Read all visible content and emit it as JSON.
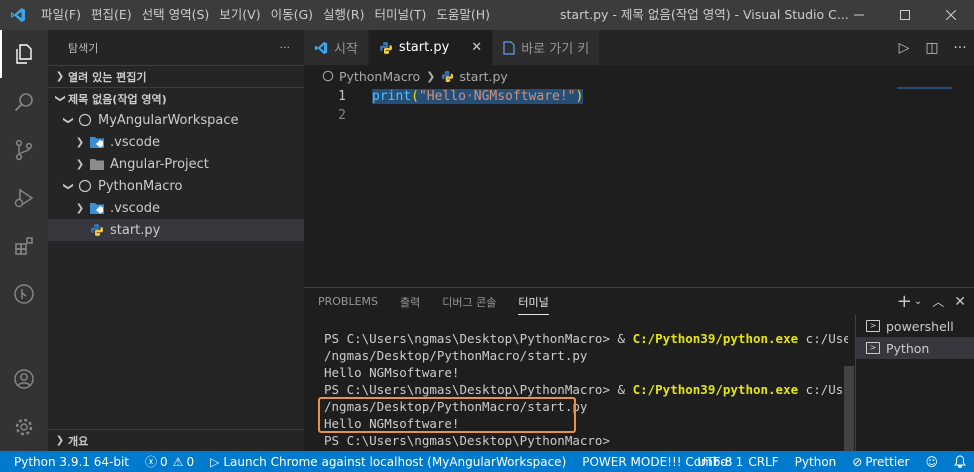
{
  "titlebar": {
    "menu": [
      "파일(F)",
      "편집(E)",
      "선택 영역(S)",
      "보기(V)",
      "이동(G)",
      "실행(R)",
      "터미널(T)",
      "도움말(H)"
    ],
    "title": "start.py - 제목 없음(작업 영역) - Visual Studio C..."
  },
  "sidebar": {
    "header": "탐색기",
    "more": "···",
    "open_editors": "열려 있는 편집기",
    "workspace": "제목 없음(작업 영역)",
    "tree": [
      {
        "label": "MyAngularWorkspace"
      },
      {
        "label": ".vscode"
      },
      {
        "label": "Angular-Project"
      },
      {
        "label": "PythonMacro"
      },
      {
        "label": ".vscode"
      },
      {
        "label": "start.py"
      }
    ],
    "outline": "개요"
  },
  "tabs": [
    {
      "label": "시작"
    },
    {
      "label": "start.py",
      "close": "✕"
    },
    {
      "label": "바로 가기 키"
    }
  ],
  "breadcrumb": {
    "folder": "PythonMacro",
    "file": "start.py"
  },
  "editor": {
    "lines": [
      {
        "num": "1",
        "fn": "print",
        "open": "(",
        "str": "\"Hello·NGMsoftware!\"",
        "close": ")"
      },
      {
        "num": "2"
      }
    ]
  },
  "panel": {
    "tabs": [
      "PROBLEMS",
      "출력",
      "디버그 콘솔",
      "터미널"
    ],
    "terminal": {
      "line1_prefix": "PS C:\\Users\\ngmas\\Desktop\\PythonMacro> & ",
      "line1_cmd": "C:/Python39/python.exe",
      "line1_suffix": " c:/Users",
      "line2": "/ngmas/Desktop/PythonMacro/start.py",
      "line3": "Hello NGMsoftware!",
      "line4_prefix": "PS C:\\Users\\ngmas\\Desktop\\PythonMacro> & ",
      "line4_cmd": "C:/Python39/python.exe",
      "line4_suffix": " c:/Users",
      "line5": "/ngmas/Desktop/PythonMacro/start.py",
      "line6": "Hello NGMsoftware!",
      "line7": "PS C:\\Users\\ngmas\\Desktop\\PythonMacro>"
    },
    "terminals": [
      "powershell",
      "Python"
    ]
  },
  "statusbar": {
    "python": "Python 3.9.1 64-bit",
    "errors": "0",
    "warnings": "0",
    "launch": "Launch Chrome against localhost (MyAngularWorkspace)",
    "power": "POWER MODE!!! Combo: 1",
    "encoding": "UTF-8",
    "eol": "CRLF",
    "language": "Python",
    "prettier": "Prettier"
  },
  "colors": {
    "accent": "#007acc",
    "highlight_box": "#e5944a",
    "selection": "#264f78"
  }
}
